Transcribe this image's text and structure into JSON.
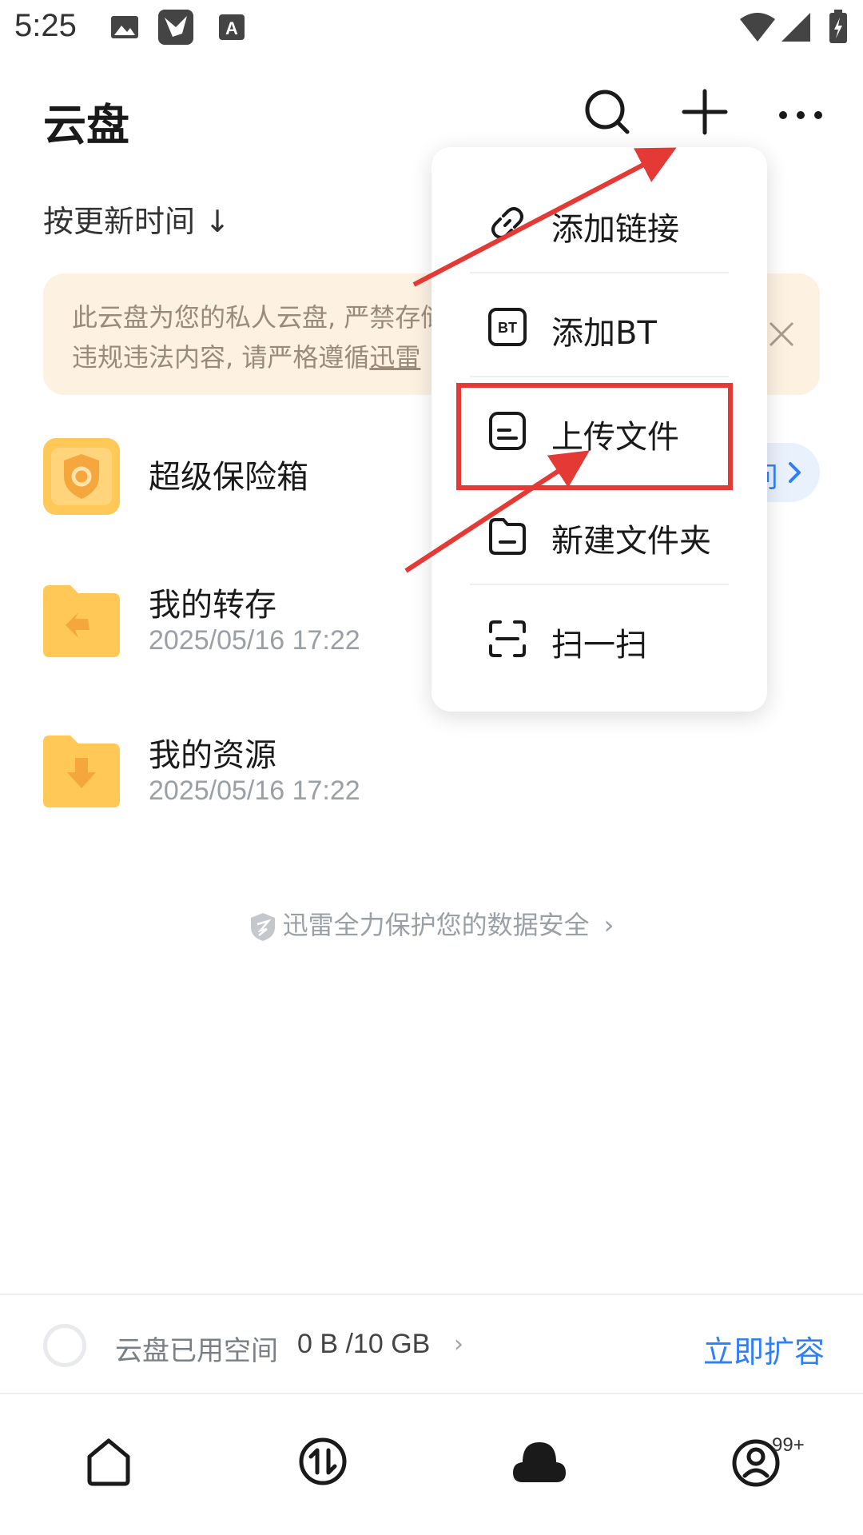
{
  "status_bar": {
    "time": "5:25",
    "icons": [
      "image-icon",
      "bird-app-icon",
      "font-a-icon",
      "wifi-icon",
      "signal-icon",
      "battery-charging-icon"
    ]
  },
  "header": {
    "title": "云盘",
    "actions": [
      "search-icon",
      "add-icon",
      "more-icon"
    ]
  },
  "sort": {
    "label": "按更新时间 ↓"
  },
  "notice": {
    "line1": "此云盘为您的私人云盘, 严禁存储",
    "line2_prefix": "违规违法内容, 请严格遵循",
    "line2_link": "迅雷",
    "close_icon": "close-icon"
  },
  "list": [
    {
      "name": "超级保险箱",
      "date": "",
      "icon": "vault-icon"
    },
    {
      "name": "我的转存",
      "date": "2025/05/16 17:22",
      "icon": "folder-transfer-icon"
    },
    {
      "name": "我的资源",
      "date": "2025/05/16 17:22",
      "icon": "folder-download-icon"
    }
  ],
  "vault_button": {
    "label": "问",
    "icon": "chevron-right-icon"
  },
  "security": {
    "text": "迅雷全力保护您的数据安全",
    "chevron": "›"
  },
  "storage": {
    "label": "云盘已用空间",
    "value": "0 B /10 GB",
    "chevron": "›",
    "expand": "立即扩容"
  },
  "menu": {
    "items": [
      {
        "label": "添加链接",
        "icon": "link-icon"
      },
      {
        "label": "添加BT",
        "icon": "bt-icon"
      },
      {
        "label": "上传文件",
        "icon": "file-icon"
      },
      {
        "label": "新建文件夹",
        "icon": "new-folder-icon"
      },
      {
        "label": "扫一扫",
        "icon": "scan-icon"
      }
    ]
  },
  "bottom_nav": {
    "items": [
      "home-icon",
      "transfer-icon",
      "cloud-icon",
      "profile-icon"
    ],
    "badge": "99+"
  },
  "colors": {
    "accent": "#2f7ff6",
    "notice_bg": "#fdf1e2",
    "annotation_red": "#e53935",
    "folder_yellow": "#ffc857"
  }
}
